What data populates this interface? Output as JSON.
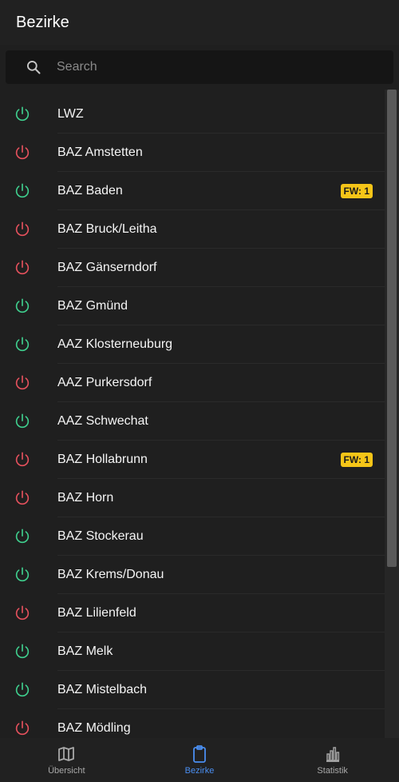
{
  "header": {
    "title": "Bezirke"
  },
  "search": {
    "placeholder": "Search",
    "value": ""
  },
  "colors": {
    "online": "#3fcf8e",
    "offline": "#e5515d",
    "badge": "#f5c518",
    "accent": "#4a8ef0"
  },
  "items": [
    {
      "label": "LWZ",
      "status": "online",
      "badge": ""
    },
    {
      "label": "BAZ Amstetten",
      "status": "offline",
      "badge": ""
    },
    {
      "label": "BAZ Baden",
      "status": "online",
      "badge": "FW: 1"
    },
    {
      "label": "BAZ Bruck/Leitha",
      "status": "offline",
      "badge": ""
    },
    {
      "label": "BAZ Gänserndorf",
      "status": "offline",
      "badge": ""
    },
    {
      "label": "BAZ Gmünd",
      "status": "online",
      "badge": ""
    },
    {
      "label": "AAZ Klosterneuburg",
      "status": "online",
      "badge": ""
    },
    {
      "label": "AAZ Purkersdorf",
      "status": "offline",
      "badge": ""
    },
    {
      "label": "AAZ Schwechat",
      "status": "online",
      "badge": ""
    },
    {
      "label": "BAZ Hollabrunn",
      "status": "offline",
      "badge": "FW: 1"
    },
    {
      "label": "BAZ Horn",
      "status": "offline",
      "badge": ""
    },
    {
      "label": "BAZ Stockerau",
      "status": "online",
      "badge": ""
    },
    {
      "label": "BAZ Krems/Donau",
      "status": "online",
      "badge": ""
    },
    {
      "label": "BAZ Lilienfeld",
      "status": "offline",
      "badge": ""
    },
    {
      "label": "BAZ Melk",
      "status": "online",
      "badge": ""
    },
    {
      "label": "BAZ Mistelbach",
      "status": "online",
      "badge": ""
    },
    {
      "label": "BAZ Mödling",
      "status": "offline",
      "badge": ""
    }
  ],
  "nav": [
    {
      "label": "Übersicht",
      "icon": "map-icon",
      "active": false
    },
    {
      "label": "Bezirke",
      "icon": "clipboard-icon",
      "active": true
    },
    {
      "label": "Statistik",
      "icon": "bar-chart-icon",
      "active": false
    }
  ]
}
